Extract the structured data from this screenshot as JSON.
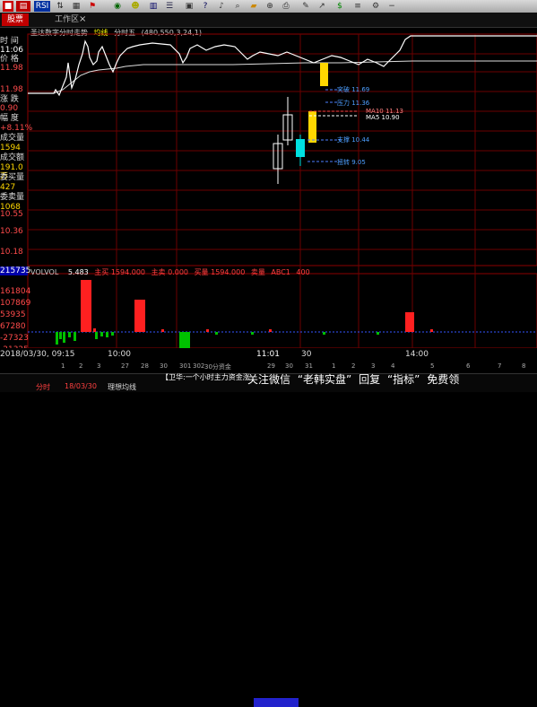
{
  "toolbar": {
    "rsi_label": "RSI",
    "icons": [
      "window-icon",
      "chart-icon",
      "rsi-icon",
      "sort-icon",
      "grid-icon",
      "flag-icon",
      "globe-icon",
      "people-icon",
      "book-icon",
      "list-icon",
      "calc-icon",
      "help-icon",
      "bell-icon",
      "search-icon",
      "folder-icon",
      "zoom-icon",
      "print-icon",
      "tool-icon",
      "arrow-icon",
      "money-icon",
      "lines-icon",
      "gear-icon",
      "minus-icon"
    ]
  },
  "tabs": {
    "active": "股票",
    "workspace": "工作区",
    "close": "×"
  },
  "chart_header": {
    "title": "圣达数字分时走势",
    "mode": "均线",
    "period": "分时五",
    "info": "(480,550,3,24,1)"
  },
  "left_panel": {
    "time_label": "时 间",
    "time_value": "11:06",
    "price_label": "价 格",
    "price_value": "11.98",
    "change_label": "涨 跌",
    "change_value": "0.90",
    "pct_label": "幅 度",
    "pct_value": "+8.11%",
    "vol_label": "成交量",
    "vol_value": "1594",
    "amt_label": "成交额",
    "amt_value": "191.0万",
    "buy_label": "委买量",
    "buy_value": "427",
    "sell_label": "委卖量",
    "sell_value": "1068",
    "price_axis": [
      "10.55",
      "10.36",
      "10.18"
    ],
    "indicator_axis": [
      "215735",
      "161804",
      "107869",
      "53935",
      "67280",
      "-27323",
      "-21325"
    ]
  },
  "indicator_bar": {
    "name": "VOLVOL",
    "v1": "5.483",
    "l2": "主买",
    "v2": "1594.000",
    "l3": "主卖",
    "v3": "0.000",
    "l4": "买量",
    "v4": "1594.000",
    "l5": "卖量",
    "v5": "ABC1",
    "v6": "400"
  },
  "annotations": {
    "break_up": "突破 11.69",
    "pressure": "压力 11.36",
    "ma10": "MA10 11.13",
    "ma5": "MA5 10.90",
    "support": "支撑 10.44",
    "turn": "扭转 9.05"
  },
  "time_axis": {
    "start": "2018/03/30, 09:15",
    "t1": "10:00",
    "t2": "11:01",
    "t3": "30",
    "t4": "14:00",
    "small": [
      "1",
      "2",
      "3",
      "27",
      "28",
      "30",
      "301",
      "302",
      "30分资金",
      "29",
      "30",
      "31",
      "1",
      "2",
      "3",
      "4",
      "5",
      "6",
      "7",
      "8"
    ]
  },
  "bottom": {
    "ticker_msg": "【卫华:一个小时主力资金涨",
    "row2_a": "分时",
    "row2_b": "18/03/30",
    "row2_c": "理想均线",
    "watermark_1": "关注微信",
    "watermark_2": "“老韩实盘”",
    "watermark_3": "回复",
    "watermark_4": "“指标”",
    "watermark_5": "免费领"
  },
  "colors": {
    "up": "#ff2020",
    "down": "#00c000",
    "yellow": "#ffd700",
    "cyan": "#00e0e0",
    "grid_red": "#8b0000",
    "price_line": "#ffffff",
    "avg_line": "#ffffff"
  }
}
